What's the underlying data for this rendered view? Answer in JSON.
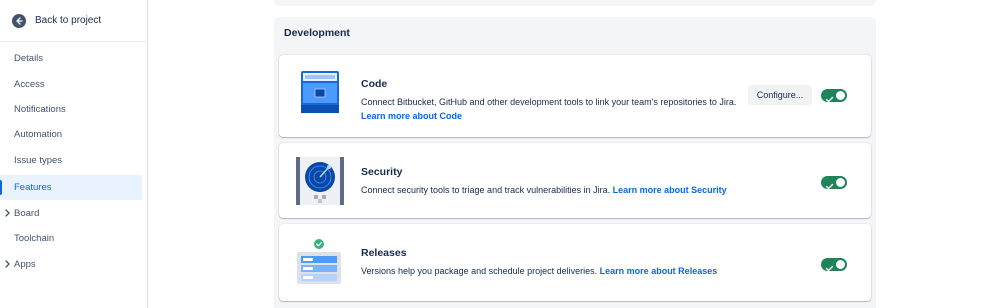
{
  "sidebar": {
    "back_label": "Back to project",
    "items": [
      {
        "label": "Details"
      },
      {
        "label": "Access"
      },
      {
        "label": "Notifications"
      },
      {
        "label": "Automation"
      },
      {
        "label": "Issue types"
      },
      {
        "label": "Features",
        "active": true
      },
      {
        "label": "Board",
        "expandable": true
      },
      {
        "label": "Toolchain"
      },
      {
        "label": "Apps",
        "expandable": true
      }
    ]
  },
  "main": {
    "section_title": "Development",
    "cards": [
      {
        "title": "Code",
        "description": "Connect Bitbucket, GitHub and other development tools to link your team's repositories to Jira.",
        "link": "Learn more about Code",
        "configure_label": "Configure...",
        "enabled": true,
        "icon": "code-illustration"
      },
      {
        "title": "Security",
        "description": "Connect security tools to triage and track vulnerabilities in Jira.",
        "link": "Learn more about Security",
        "enabled": true,
        "icon": "security-illustration"
      },
      {
        "title": "Releases",
        "description": "Versions help you package and schedule project deliveries.",
        "link": "Learn more about Releases",
        "enabled": true,
        "icon": "releases-illustration"
      }
    ]
  },
  "colors": {
    "accent": "#0c66e4",
    "toggle_on": "#1f845a",
    "section_bg": "#f4f5f7",
    "active_bg": "#e9f2ff"
  }
}
